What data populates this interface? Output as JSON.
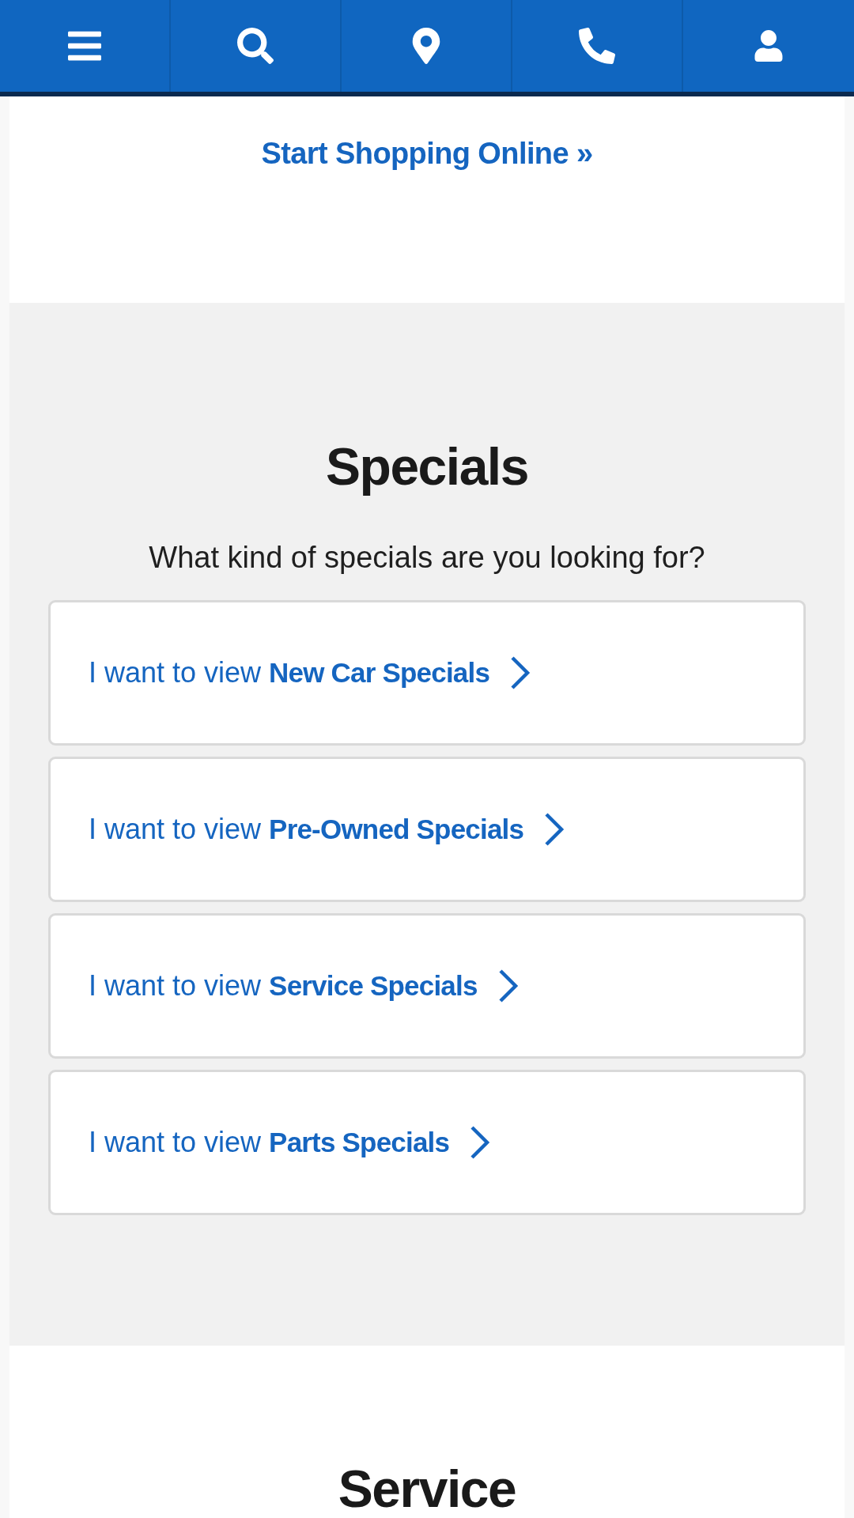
{
  "shop_link": {
    "label": "Start Shopping Online »"
  },
  "specials": {
    "title": "Specials",
    "subtitle": "What kind of specials are you looking for?",
    "options": [
      {
        "text": "I want to view **New Car Specials**"
      },
      {
        "text": "I want to view **Pre-Owned Specials**"
      },
      {
        "text": "I want to view **Service Specials**"
      },
      {
        "text": "I want to view **Parts Specials**"
      }
    ]
  },
  "next_section": {
    "title": "Service"
  }
}
